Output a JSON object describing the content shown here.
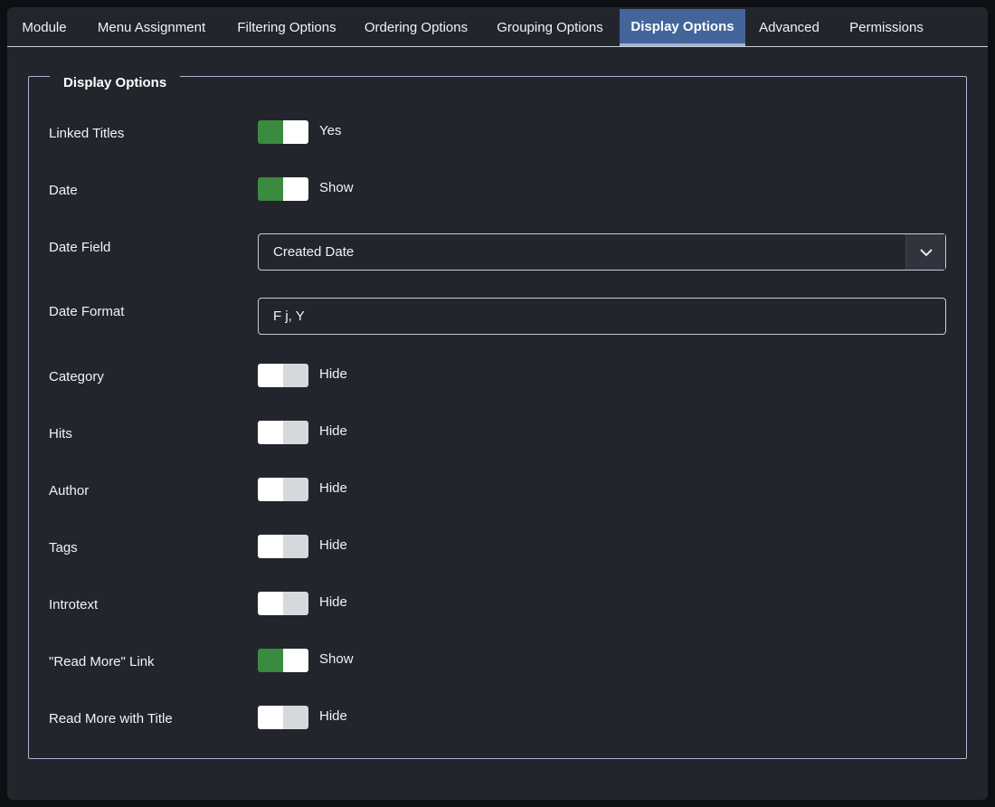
{
  "tabs": [
    {
      "label": "Module"
    },
    {
      "label": "Menu Assignment"
    },
    {
      "label": "Filtering Options"
    },
    {
      "label": "Ordering Options"
    },
    {
      "label": "Grouping Options"
    },
    {
      "label": "Display Options"
    },
    {
      "label": "Advanced"
    },
    {
      "label": "Permissions"
    }
  ],
  "active_tab": "Display Options",
  "fieldset": {
    "legend": "Display Options"
  },
  "rows": {
    "linked_titles": {
      "label": "Linked Titles",
      "state": "Yes",
      "on": true
    },
    "date": {
      "label": "Date",
      "state": "Show",
      "on": true
    },
    "date_field": {
      "label": "Date Field",
      "value": "Created Date"
    },
    "date_format": {
      "label": "Date Format",
      "value": "F j, Y"
    },
    "category": {
      "label": "Category",
      "state": "Hide",
      "on": false
    },
    "hits": {
      "label": "Hits",
      "state": "Hide",
      "on": false
    },
    "author": {
      "label": "Author",
      "state": "Hide",
      "on": false
    },
    "tags": {
      "label": "Tags",
      "state": "Hide",
      "on": false
    },
    "introtext": {
      "label": "Introtext",
      "state": "Hide",
      "on": false
    },
    "read_more_link": {
      "label": "\"Read More\" Link",
      "state": "Show",
      "on": true
    },
    "read_more_title": {
      "label": "Read More with Title",
      "state": "Hide",
      "on": false
    }
  },
  "icons": {
    "select_caret": "chevron-down-icon"
  },
  "colors": {
    "background": "#22252c",
    "active_tab": "#43659a",
    "switch_on": "#3a8a3f",
    "switch_off": "#d6d8dc"
  }
}
